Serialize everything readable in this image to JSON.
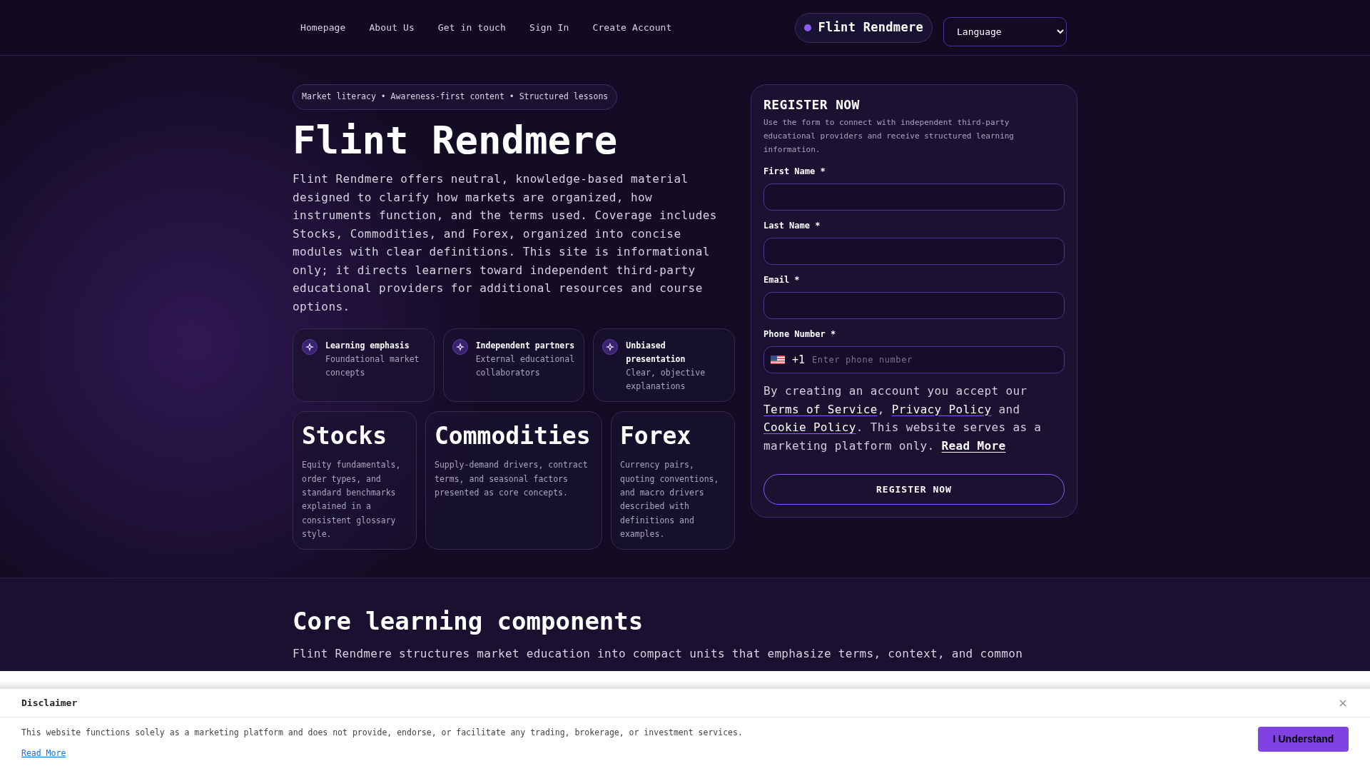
{
  "nav": {
    "links": [
      {
        "label": "Homepage"
      },
      {
        "label": "About Us"
      },
      {
        "label": "Get in touch"
      },
      {
        "label": "Sign In"
      },
      {
        "label": "Create Account"
      }
    ],
    "brand": "Flint Rendmere",
    "language_select": {
      "value": "Language"
    }
  },
  "hero": {
    "badge": "Market literacy • Awareness-first content • Structured lessons",
    "title": "Flint Rendmere",
    "description": "Flint Rendmere offers neutral, knowledge-based material designed to clarify how markets are organized, how instruments function, and the terms used. Coverage includes Stocks, Commodities, and Forex, organized into concise modules with clear definitions. This site is informational only; it directs learners toward independent third-party educational providers for additional resources and course options.",
    "features": [
      {
        "title": "Learning emphasis",
        "text": "Foundational market concepts"
      },
      {
        "title": "Independent partners",
        "text": "External educational collaborators"
      },
      {
        "title": "Unbiased presentation",
        "text": "Clear, objective explanations"
      }
    ],
    "topics": [
      {
        "title": "Stocks",
        "text": "Equity fundamentals, order types, and standard benchmarks explained in a consistent glossary style."
      },
      {
        "title": "Commodities",
        "text": "Supply-demand drivers, contract terms, and seasonal factors presented as core concepts."
      },
      {
        "title": "Forex",
        "text": "Currency pairs, quoting conventions, and macro drivers described with definitions and examples."
      }
    ]
  },
  "register_form": {
    "title": "REGISTER NOW",
    "description": "Use the form to connect with independent third-party educational providers and receive structured learning information.",
    "fields": [
      {
        "kind": "text",
        "label": "First Name *"
      },
      {
        "kind": "text",
        "label": "Last Name *"
      },
      {
        "kind": "text",
        "label": "Email *"
      },
      {
        "kind": "phone",
        "label": "Phone Number *",
        "dial_code": "+1",
        "placeholder": "Enter phone number"
      }
    ],
    "consent": [
      {
        "kind": "text",
        "text": "By creating an account you accept our "
      },
      {
        "kind": "link",
        "text": "Terms of Service"
      },
      {
        "kind": "text",
        "text": ", "
      },
      {
        "kind": "link",
        "text": "Privacy Policy"
      },
      {
        "kind": "text",
        "text": " and "
      },
      {
        "kind": "link",
        "text": "Cookie Policy"
      },
      {
        "kind": "text",
        "text": ". This website serves as a marketing platform only. "
      },
      {
        "kind": "strong_link",
        "text": "Read More"
      }
    ],
    "submit": "REGISTER NOW"
  },
  "core_section": {
    "title": "Core learning components",
    "description": "Flint Rendmere structures market education into compact units that emphasize terms, context, and common"
  },
  "disclaimer": {
    "title": "Disclaimer",
    "text": "This website functions solely as a marketing platform and does not provide, endorse, or facilitate any trading, brokerage, or investment services.",
    "link": "Read More",
    "button": "I Understand"
  }
}
